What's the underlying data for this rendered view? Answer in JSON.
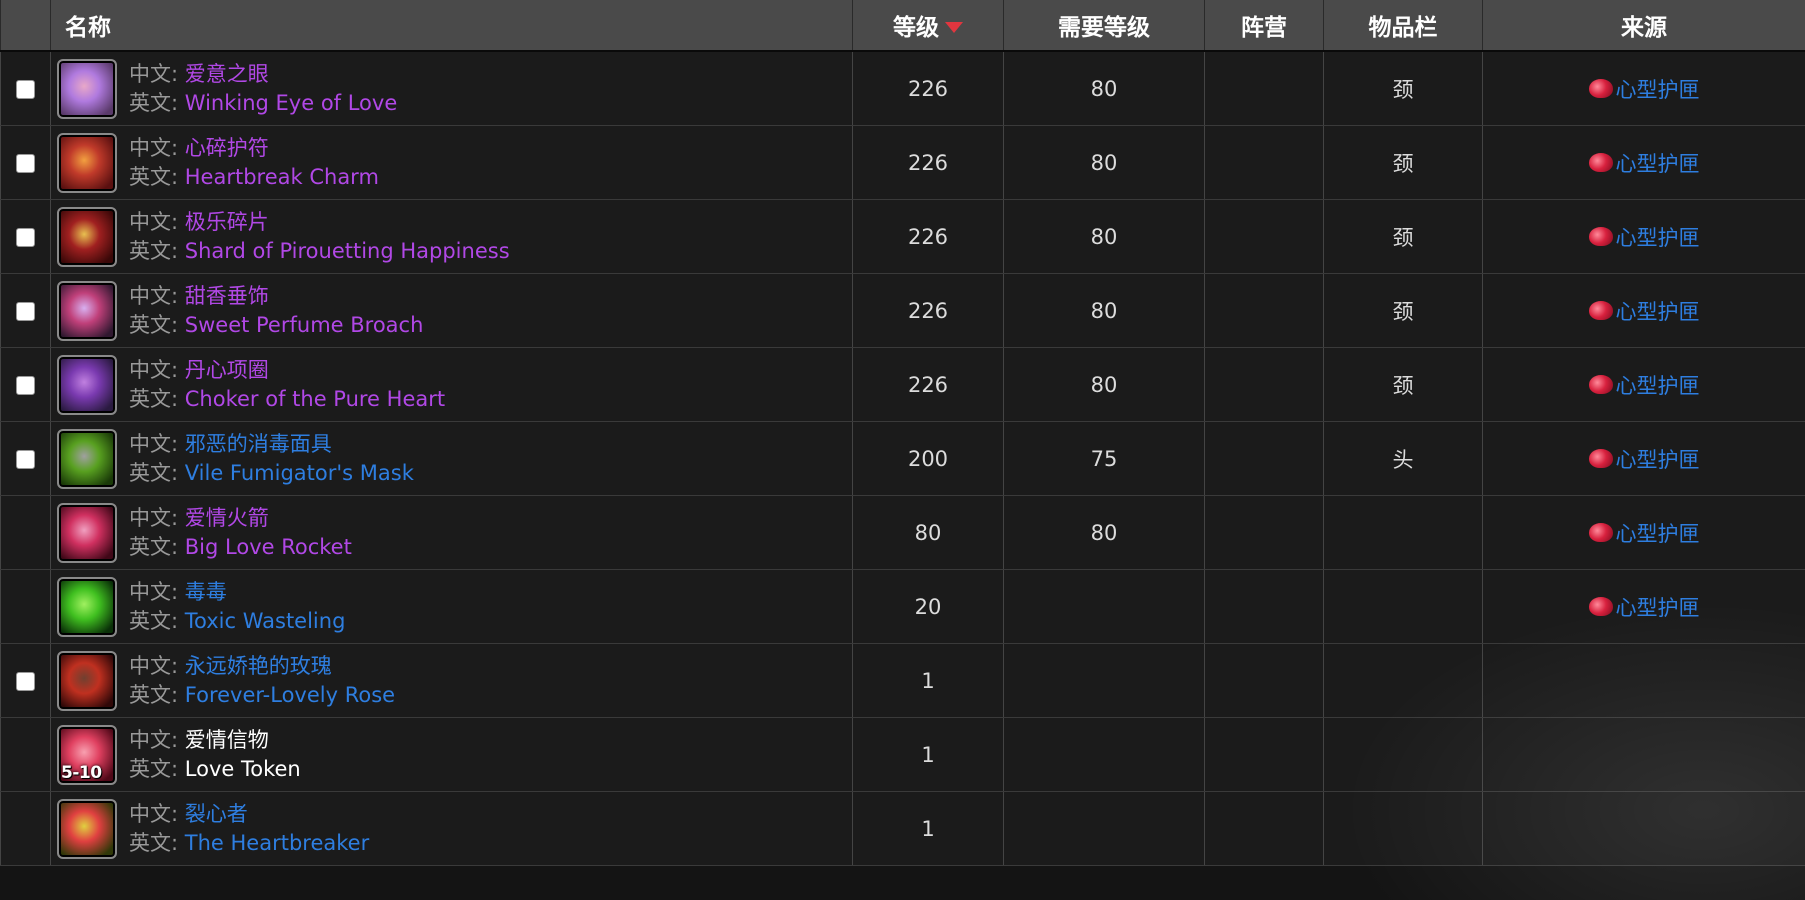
{
  "header": {
    "name": "名称",
    "level": "等级",
    "req_level": "需要等级",
    "faction": "阵营",
    "slot": "物品栏",
    "source": "来源"
  },
  "labels": {
    "cn": "中文:",
    "en": "英文:"
  },
  "rows": [
    {
      "cn": "爱意之眼",
      "en": "Winking Eye of Love",
      "level": "226",
      "req": "80",
      "slot": "颈",
      "source": "心型护匣",
      "quality": "purple",
      "has_checkbox": true,
      "icon": "heart-amulet-icon",
      "icon_colors": [
        "#5a3a6a",
        "#b07adf",
        "#e8a8c8"
      ]
    },
    {
      "cn": "心碎护符",
      "en": "Heartbreak Charm",
      "level": "226",
      "req": "80",
      "slot": "颈",
      "source": "心型护匣",
      "quality": "purple",
      "has_checkbox": true,
      "icon": "charm-icon",
      "icon_colors": [
        "#5a1010",
        "#c03a2a",
        "#f2a040"
      ]
    },
    {
      "cn": "极乐碎片",
      "en": "Shard of Pirouetting Happiness",
      "level": "226",
      "req": "80",
      "slot": "颈",
      "source": "心型护匣",
      "quality": "purple",
      "has_checkbox": true,
      "icon": "shard-icon",
      "icon_colors": [
        "#3a0808",
        "#a02020",
        "#e8c050"
      ]
    },
    {
      "cn": "甜香垂饰",
      "en": "Sweet Perfume Broach",
      "level": "226",
      "req": "80",
      "slot": "颈",
      "source": "心型护匣",
      "quality": "purple",
      "has_checkbox": true,
      "icon": "broach-icon",
      "icon_colors": [
        "#301830",
        "#c0407a",
        "#d8b0f0"
      ]
    },
    {
      "cn": "丹心项圈",
      "en": "Choker of the Pure Heart",
      "level": "226",
      "req": "80",
      "slot": "颈",
      "source": "心型护匣",
      "quality": "purple",
      "has_checkbox": true,
      "icon": "choker-icon",
      "icon_colors": [
        "#2a1a40",
        "#7a3ab0",
        "#c080e0"
      ]
    },
    {
      "cn": "邪恶的消毒面具",
      "en": "Vile Fumigator's Mask",
      "level": "200",
      "req": "75",
      "slot": "头",
      "source": "心型护匣",
      "quality": "blue",
      "has_checkbox": true,
      "icon": "mask-icon",
      "icon_colors": [
        "#1a3a08",
        "#58a020",
        "#a0a0a0"
      ]
    },
    {
      "cn": "爱情火箭",
      "en": "Big Love Rocket",
      "level": "80",
      "req": "80",
      "slot": "",
      "source": "心型护匣",
      "quality": "purple",
      "has_checkbox": false,
      "icon": "rocket-icon",
      "icon_colors": [
        "#400818",
        "#d03060",
        "#f0a0c0"
      ]
    },
    {
      "cn": "毒毒",
      "en": "Toxic Wasteling",
      "level": "20",
      "req": "",
      "slot": "",
      "source": "心型护匣",
      "quality": "blue",
      "has_checkbox": false,
      "icon": "toxic-icon",
      "icon_colors": [
        "#0a3008",
        "#40c020",
        "#a0f060"
      ]
    },
    {
      "cn": "永远娇艳的玫瑰",
      "en": "Forever-Lovely Rose",
      "level": "1",
      "req": "",
      "slot": "",
      "source": "",
      "quality": "blue",
      "has_checkbox": true,
      "icon": "rose-icon",
      "icon_colors": [
        "#300808",
        "#c03020",
        "#704030"
      ]
    },
    {
      "cn": "爱情信物",
      "en": "Love Token",
      "level": "1",
      "req": "",
      "slot": "",
      "source": "",
      "quality": "white",
      "has_checkbox": false,
      "icon": "love-token-icon",
      "badge": "5-10",
      "icon_colors": [
        "#500818",
        "#e04060",
        "#f8a0b0"
      ]
    },
    {
      "cn": "裂心者",
      "en": "The Heartbreaker",
      "level": "1",
      "req": "",
      "slot": "",
      "source": "",
      "quality": "blue",
      "has_checkbox": false,
      "icon": "broken-heart-icon",
      "icon_colors": [
        "#303808",
        "#e04040",
        "#e0d040"
      ]
    }
  ]
}
